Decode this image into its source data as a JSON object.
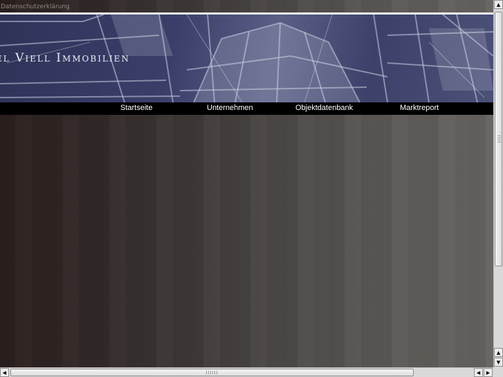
{
  "top_bar": {
    "privacy_link": "Datenschutzerklärung"
  },
  "banner": {
    "title": "el Viell Immobilien"
  },
  "nav": {
    "items": [
      {
        "label": "Startseite"
      },
      {
        "label": "Unternehmen"
      },
      {
        "label": "Objektdatenbank"
      },
      {
        "label": "Marktreport"
      }
    ]
  },
  "scrollbars": {
    "vertical": {
      "up_icon": "arrow-up-icon",
      "down_icon": "arrow-down-icon"
    },
    "horizontal": {
      "left_icon": "arrow-left-icon",
      "right_icon": "arrow-right-icon"
    }
  },
  "colors": {
    "nav_bg": "#000000",
    "banner_bg": "#3a3f6a",
    "page_bg": "#3b3432"
  }
}
